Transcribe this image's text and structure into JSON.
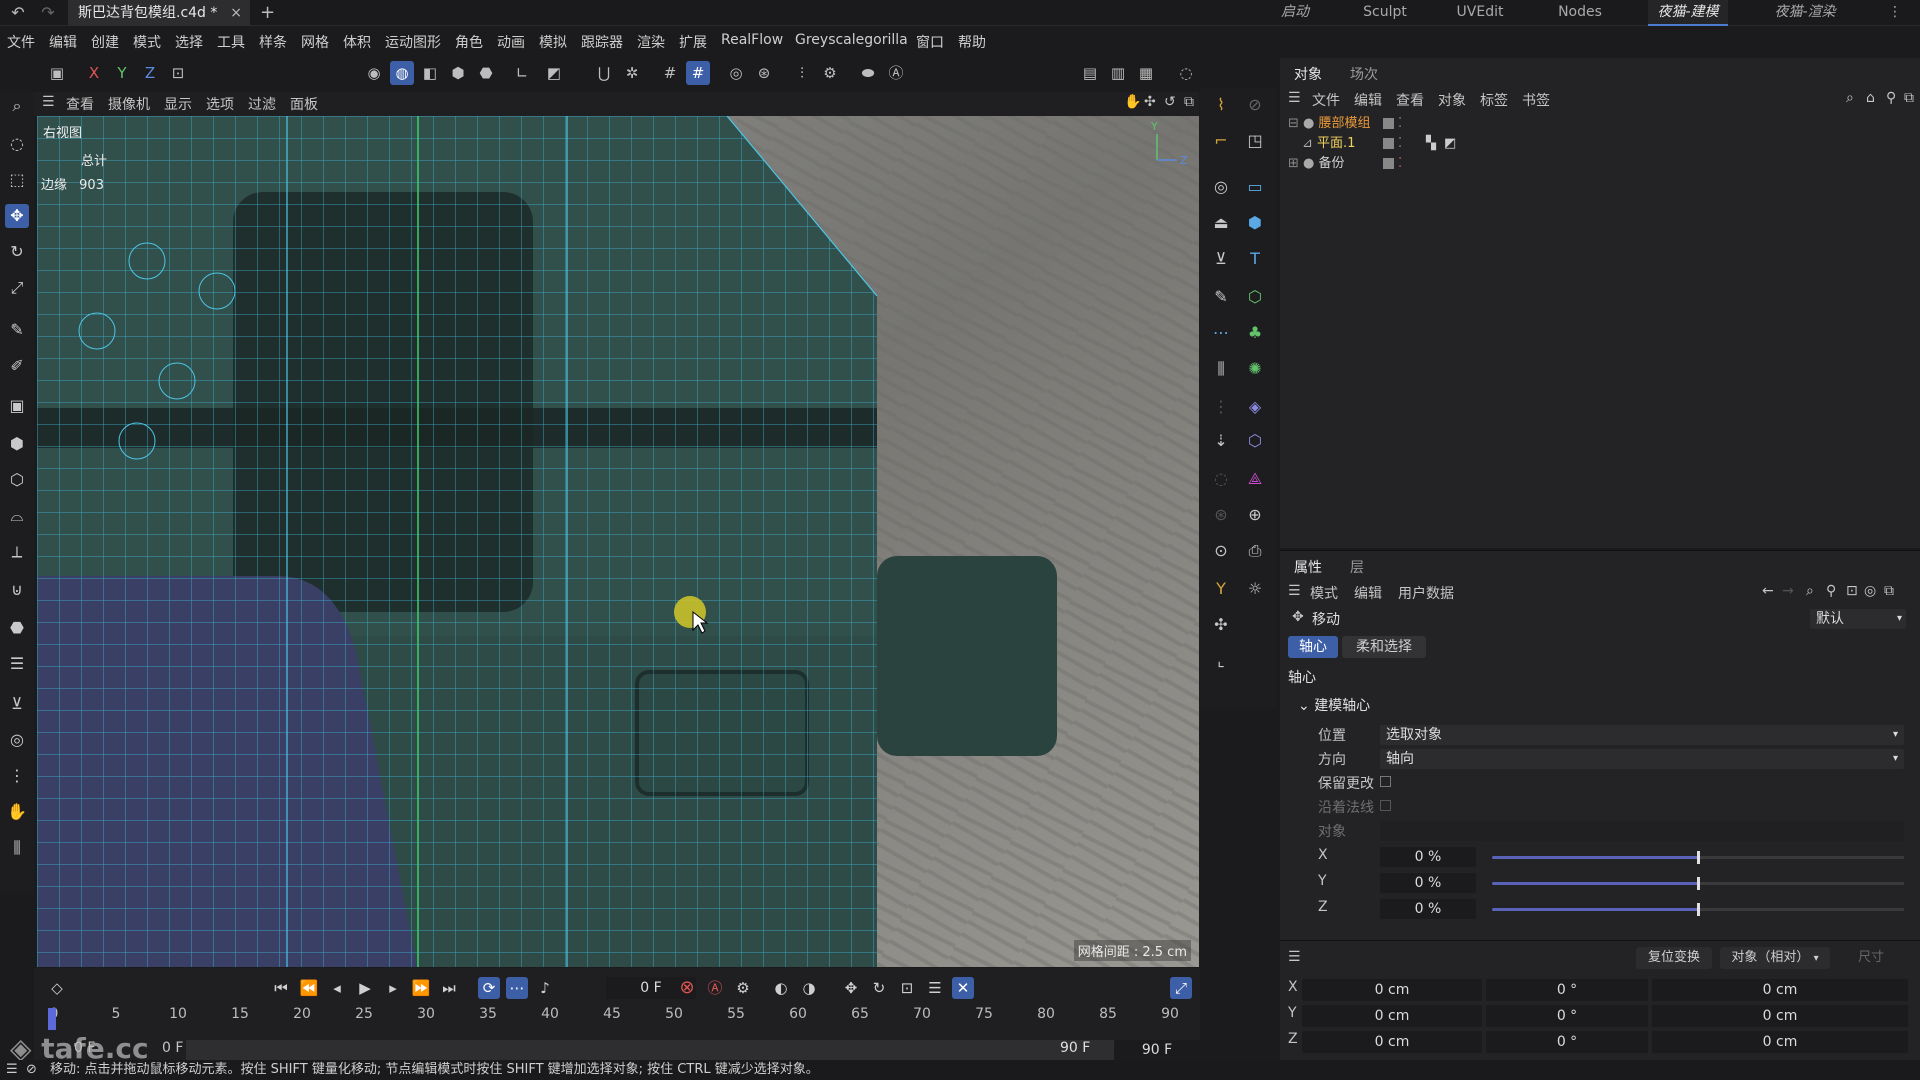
{
  "app": {
    "doc_tab": "斯巴达背包模组.c4d *",
    "doc_close": "×",
    "add_tab": "+",
    "layouts": [
      {
        "label": "启动"
      },
      {
        "label": "Sculpt"
      },
      {
        "label": "UVEdit"
      },
      {
        "label": "Nodes"
      },
      {
        "label": "夜猫-建模"
      },
      {
        "label": "夜猫-渲染"
      }
    ],
    "more": "⋮"
  },
  "menu": [
    "文件",
    "编辑",
    "创建",
    "模式",
    "选择",
    "工具",
    "样条",
    "网格",
    "体积",
    "运动图形",
    "角色",
    "动画",
    "模拟",
    "跟踪器",
    "渲染",
    "扩展",
    "RealFlow",
    "Greyscalegorilla",
    "窗口",
    "帮助"
  ],
  "toolbar": {
    "axes": [
      "X",
      "Y",
      "Z"
    ]
  },
  "viewport": {
    "menu": [
      "查看",
      "摄像机",
      "显示",
      "选项",
      "过滤",
      "面板"
    ],
    "view_name": "右视图",
    "total_label": "总计",
    "edges_label": "边缘",
    "edges_value": "903",
    "grid_spacing": "网格间距 : 2.5 cm",
    "axis_y": "Y",
    "axis_z": "Z"
  },
  "object_manager": {
    "tabs": [
      "对象",
      "场次"
    ],
    "menu": [
      "文件",
      "编辑",
      "查看",
      "对象",
      "标签",
      "书签"
    ],
    "objects": [
      {
        "name": "腰部模组",
        "color": "#e89a3a"
      },
      {
        "name": "平面.1",
        "color": "#f0d060"
      },
      {
        "name": "备份",
        "color": "#d0d0d0"
      }
    ]
  },
  "attributes": {
    "tabs": [
      "属性",
      "层"
    ],
    "menu": [
      "模式",
      "编辑",
      "用户数据"
    ],
    "tool_name": "移动",
    "preset": "默认",
    "subtabs": [
      "轴心",
      "柔和选择"
    ],
    "section": "轴心",
    "group": "建模轴心",
    "position_label": "位置",
    "position_value": "选取对象",
    "direction_label": "方向",
    "direction_value": "轴向",
    "keep_changes": "保留更改",
    "along_normal": "沿着法线",
    "object_label": "对象",
    "axes": [
      {
        "axis": "X",
        "value": "0 %",
        "fraction": 0.5
      },
      {
        "axis": "Y",
        "value": "0 %",
        "fraction": 0.5
      },
      {
        "axis": "Z",
        "value": "0 %",
        "fraction": 0.5
      }
    ]
  },
  "coordinates": {
    "reset": "复位变换",
    "mode": "对象（相对）",
    "size": "尺寸",
    "rows": [
      {
        "axis": "X",
        "pos": "0 cm",
        "rot": "0 °",
        "scale": "0 cm"
      },
      {
        "axis": "Y",
        "pos": "0 cm",
        "rot": "0 °",
        "scale": "0 cm"
      },
      {
        "axis": "Z",
        "pos": "0 cm",
        "rot": "0 °",
        "scale": "0 cm"
      }
    ]
  },
  "timeline": {
    "current_frame": "0 F",
    "ticks": [
      "0",
      "5",
      "10",
      "15",
      "20",
      "25",
      "30",
      "35",
      "40",
      "45",
      "50",
      "55",
      "60",
      "65",
      "70",
      "75",
      "80",
      "85",
      "90"
    ],
    "start": "0 F",
    "start2": "0 F",
    "end": "90 F",
    "end2": "90 F"
  },
  "watermark": "tafe.cc",
  "status": "移动: 点击并拖动鼠标移动元素。按住 SHIFT 键量化移动; 节点编辑模式时按住 SHIFT 键增加选择对象; 按住 CTRL 键减少选择对象。"
}
